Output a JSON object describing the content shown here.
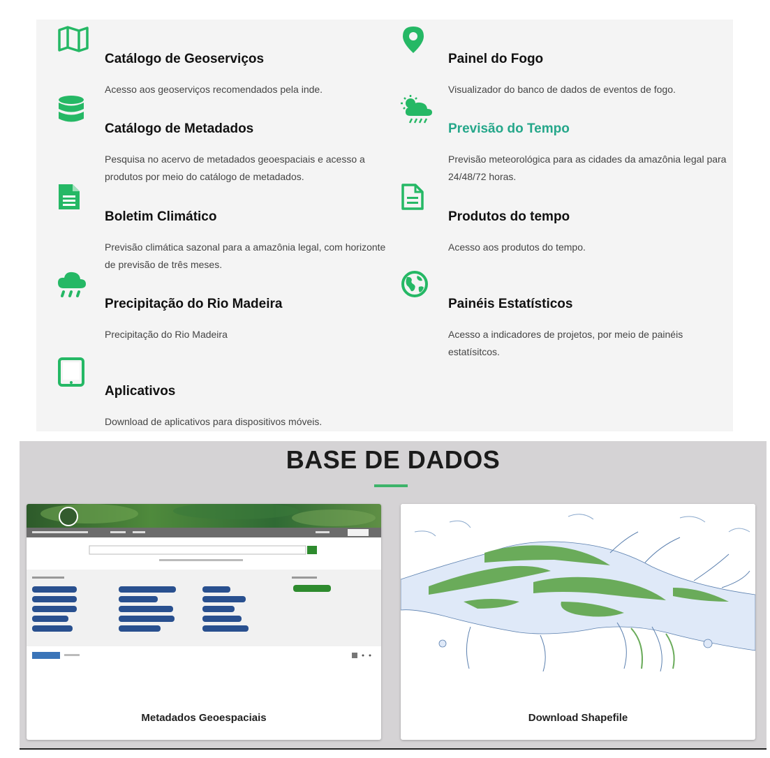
{
  "services": [
    {
      "title": "Catálogo de Geoserviços",
      "desc": "Acesso aos geoserviços recomendados pela inde.",
      "icon": "map-icon"
    },
    {
      "title": "Painel do Fogo",
      "desc": "Visualizador do banco de dados de eventos de fogo.",
      "icon": "map-pin-icon"
    },
    {
      "title": "Catálogo de Metadados",
      "desc": "Pesquisa no acervo de metadados geoespaciais e acesso a produtos por meio do catálogo de metadados.",
      "icon": "database-icon"
    },
    {
      "title": "Previsão do Tempo",
      "desc": "Previsão meteorológica para as cidades da amazônia legal para 24/48/72 horas.",
      "icon": "weather-icon"
    },
    {
      "title": "Boletim Climático",
      "desc": "Previsão climática sazonal para a amazônia legal, com horizonte de previsão de três meses.",
      "icon": "document-icon"
    },
    {
      "title": "Produtos do tempo",
      "desc": "Acesso aos produtos do tempo.",
      "icon": "document-outline-icon"
    },
    {
      "title": "Precipitação do Rio Madeira",
      "desc": "Precipitação do Rio Madeira",
      "icon": "rain-cloud-icon"
    },
    {
      "title": "Painéis Estatísticos",
      "desc": "Acesso a indicadores de projetos, por meio de painéis estatísitcos.",
      "icon": "globe-icon"
    },
    {
      "title": "Aplicativos",
      "desc": "Download de aplicativos para dispositivos móveis.",
      "icon": "tablet-icon"
    }
  ],
  "base": {
    "title": "BASE DE DADOS",
    "cards": [
      {
        "label": "Metadados Geoespaciais"
      },
      {
        "label": "Download Shapefile"
      }
    ]
  },
  "colors": {
    "accent": "#25b865",
    "link": "#25a78a",
    "river": "#dfe9f8",
    "forest": "#6aab5a"
  }
}
